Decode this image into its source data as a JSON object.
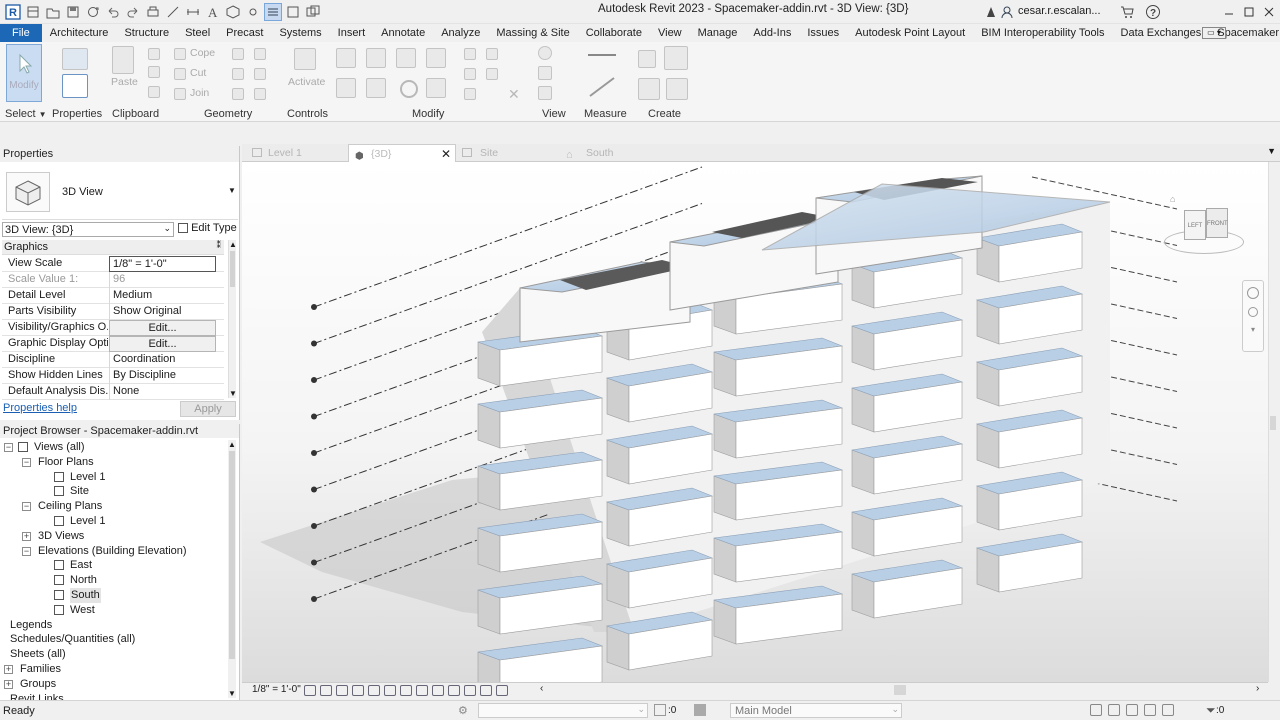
{
  "window": {
    "title": "Autodesk Revit 2023 - Spacemaker-addin.rvt - 3D View: {3D}",
    "user": "cesar.r.escalan...",
    "help_label": "?"
  },
  "ribbon_tabs": [
    "File",
    "Architecture",
    "Structure",
    "Steel",
    "Precast",
    "Systems",
    "Insert",
    "Annotate",
    "Analyze",
    "Massing & Site",
    "Collaborate",
    "View",
    "Manage",
    "Add-Ins",
    "Issues",
    "Autodesk Point Layout",
    "BIM Interoperability Tools",
    "Data Exchanges",
    "Spacemaker"
  ],
  "ribbon": {
    "select": {
      "modify": "Modify",
      "label": "Select"
    },
    "properties": {
      "label": "Properties"
    },
    "clipboard": {
      "paste": "Paste",
      "cope": "Cope",
      "cut": "Cut",
      "join": "Join",
      "label": "Clipboard"
    },
    "geometry": {
      "label": "Geometry"
    },
    "controls": {
      "activate": "Activate",
      "label": "Controls"
    },
    "modify": {
      "label": "Modify"
    },
    "view": {
      "label": "View"
    },
    "measure": {
      "label": "Measure"
    },
    "create": {
      "label": "Create"
    }
  },
  "view_tabs": [
    {
      "label": "Level 1",
      "active": false
    },
    {
      "label": "{3D}",
      "active": true
    },
    {
      "label": "Site",
      "active": false
    },
    {
      "label": "South",
      "active": false
    }
  ],
  "properties": {
    "title": "Properties",
    "type_name": "3D View",
    "instance_selector": "3D View: {3D}",
    "edit_type": "Edit Type",
    "section": "Graphics",
    "rows": [
      {
        "key": "View Scale",
        "value": "1/8\" = 1'-0\""
      },
      {
        "key": "Scale Value    1:",
        "value": "96"
      },
      {
        "key": "Detail Level",
        "value": "Medium"
      },
      {
        "key": "Parts Visibility",
        "value": "Show Original"
      },
      {
        "key": "Visibility/Graphics O...",
        "value": "Edit..."
      },
      {
        "key": "Graphic Display Opti...",
        "value": "Edit..."
      },
      {
        "key": "Discipline",
        "value": "Coordination"
      },
      {
        "key": "Show Hidden Lines",
        "value": "By Discipline"
      },
      {
        "key": "Default Analysis Dis...",
        "value": "None"
      }
    ],
    "help_link": "Properties help",
    "apply": "Apply"
  },
  "project_browser": {
    "title": "Project Browser - Spacemaker-addin.rvt",
    "nodes": [
      {
        "label": "Views (all)"
      },
      {
        "label": "Floor Plans"
      },
      {
        "label": "Level 1"
      },
      {
        "label": "Site"
      },
      {
        "label": "Ceiling Plans"
      },
      {
        "label": "Level 1"
      },
      {
        "label": "3D Views"
      },
      {
        "label": "Elevations (Building Elevation)"
      },
      {
        "label": "East"
      },
      {
        "label": "North"
      },
      {
        "label": "South"
      },
      {
        "label": "West"
      },
      {
        "label": "Legends"
      },
      {
        "label": "Schedules/Quantities (all)"
      },
      {
        "label": "Sheets (all)"
      },
      {
        "label": "Families"
      },
      {
        "label": "Groups"
      },
      {
        "label": "Revit Links"
      }
    ]
  },
  "viewcube": {
    "left": "LEFT",
    "front": "FRONT"
  },
  "view_control_bar": {
    "scale": "1/8\" = 1'-0\""
  },
  "status_bar": {
    "text": "Ready",
    "workset_count": ":0",
    "model": "Main Model",
    "filter_count": ":0"
  },
  "colors": {
    "file_tab": "#1c68b6",
    "roof_blue": "#b4cce4",
    "link_blue": "#1a5fb4"
  }
}
